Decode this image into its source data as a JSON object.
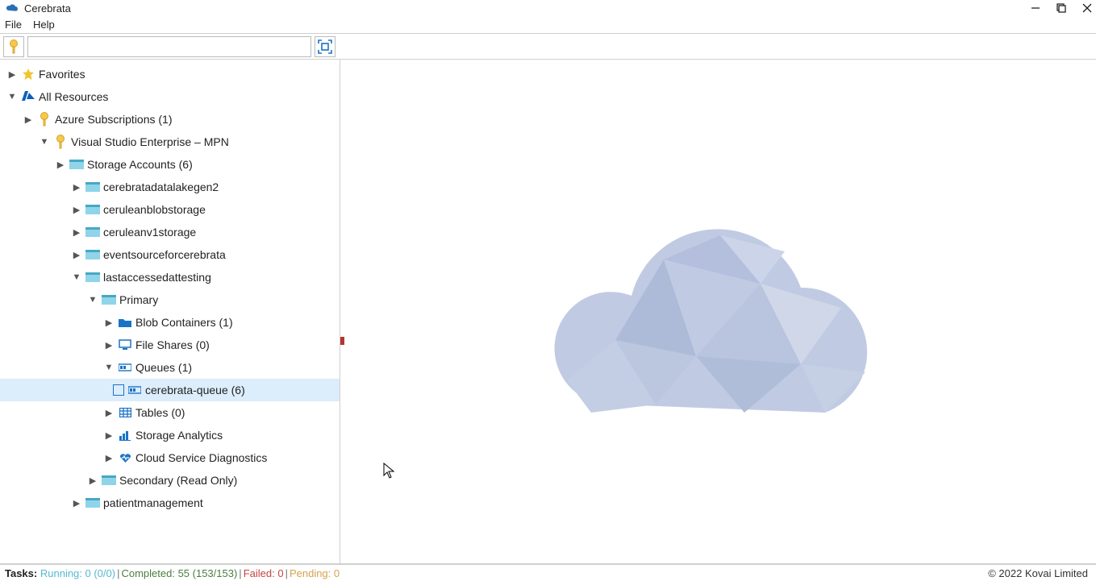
{
  "window": {
    "title": "Cerebrata"
  },
  "menu": {
    "file": "File",
    "help": "Help"
  },
  "toolbar": {
    "search_placeholder": ""
  },
  "tree": {
    "favorites": "Favorites",
    "all_resources": "All Resources",
    "azure_subscriptions": "Azure Subscriptions (1)",
    "vs_enterprise": "Visual Studio Enterprise – MPN",
    "storage_accounts": "Storage Accounts (6)",
    "sa1": "cerebratadatalakegen2",
    "sa2": "ceruleanblobstorage",
    "sa3": "ceruleanv1storage",
    "sa4": "eventsourceforcerebrata",
    "sa5": "lastaccessedattesting",
    "primary": "Primary",
    "blob_containers": "Blob Containers (1)",
    "file_shares": "File Shares (0)",
    "queues": "Queues (1)",
    "queue1": "cerebrata-queue (6)",
    "tables": "Tables (0)",
    "storage_analytics": "Storage Analytics",
    "cloud_diag": "Cloud Service Diagnostics",
    "secondary": "Secondary (Read Only)",
    "sa6": "patientmanagement"
  },
  "status": {
    "label": "Tasks:",
    "running": "Running: 0 (0/0)",
    "completed": "Completed: 55 (153/153)",
    "failed": "Failed: 0",
    "pending": "Pending: 0"
  },
  "copyright": "© 2022 Kovai Limited"
}
